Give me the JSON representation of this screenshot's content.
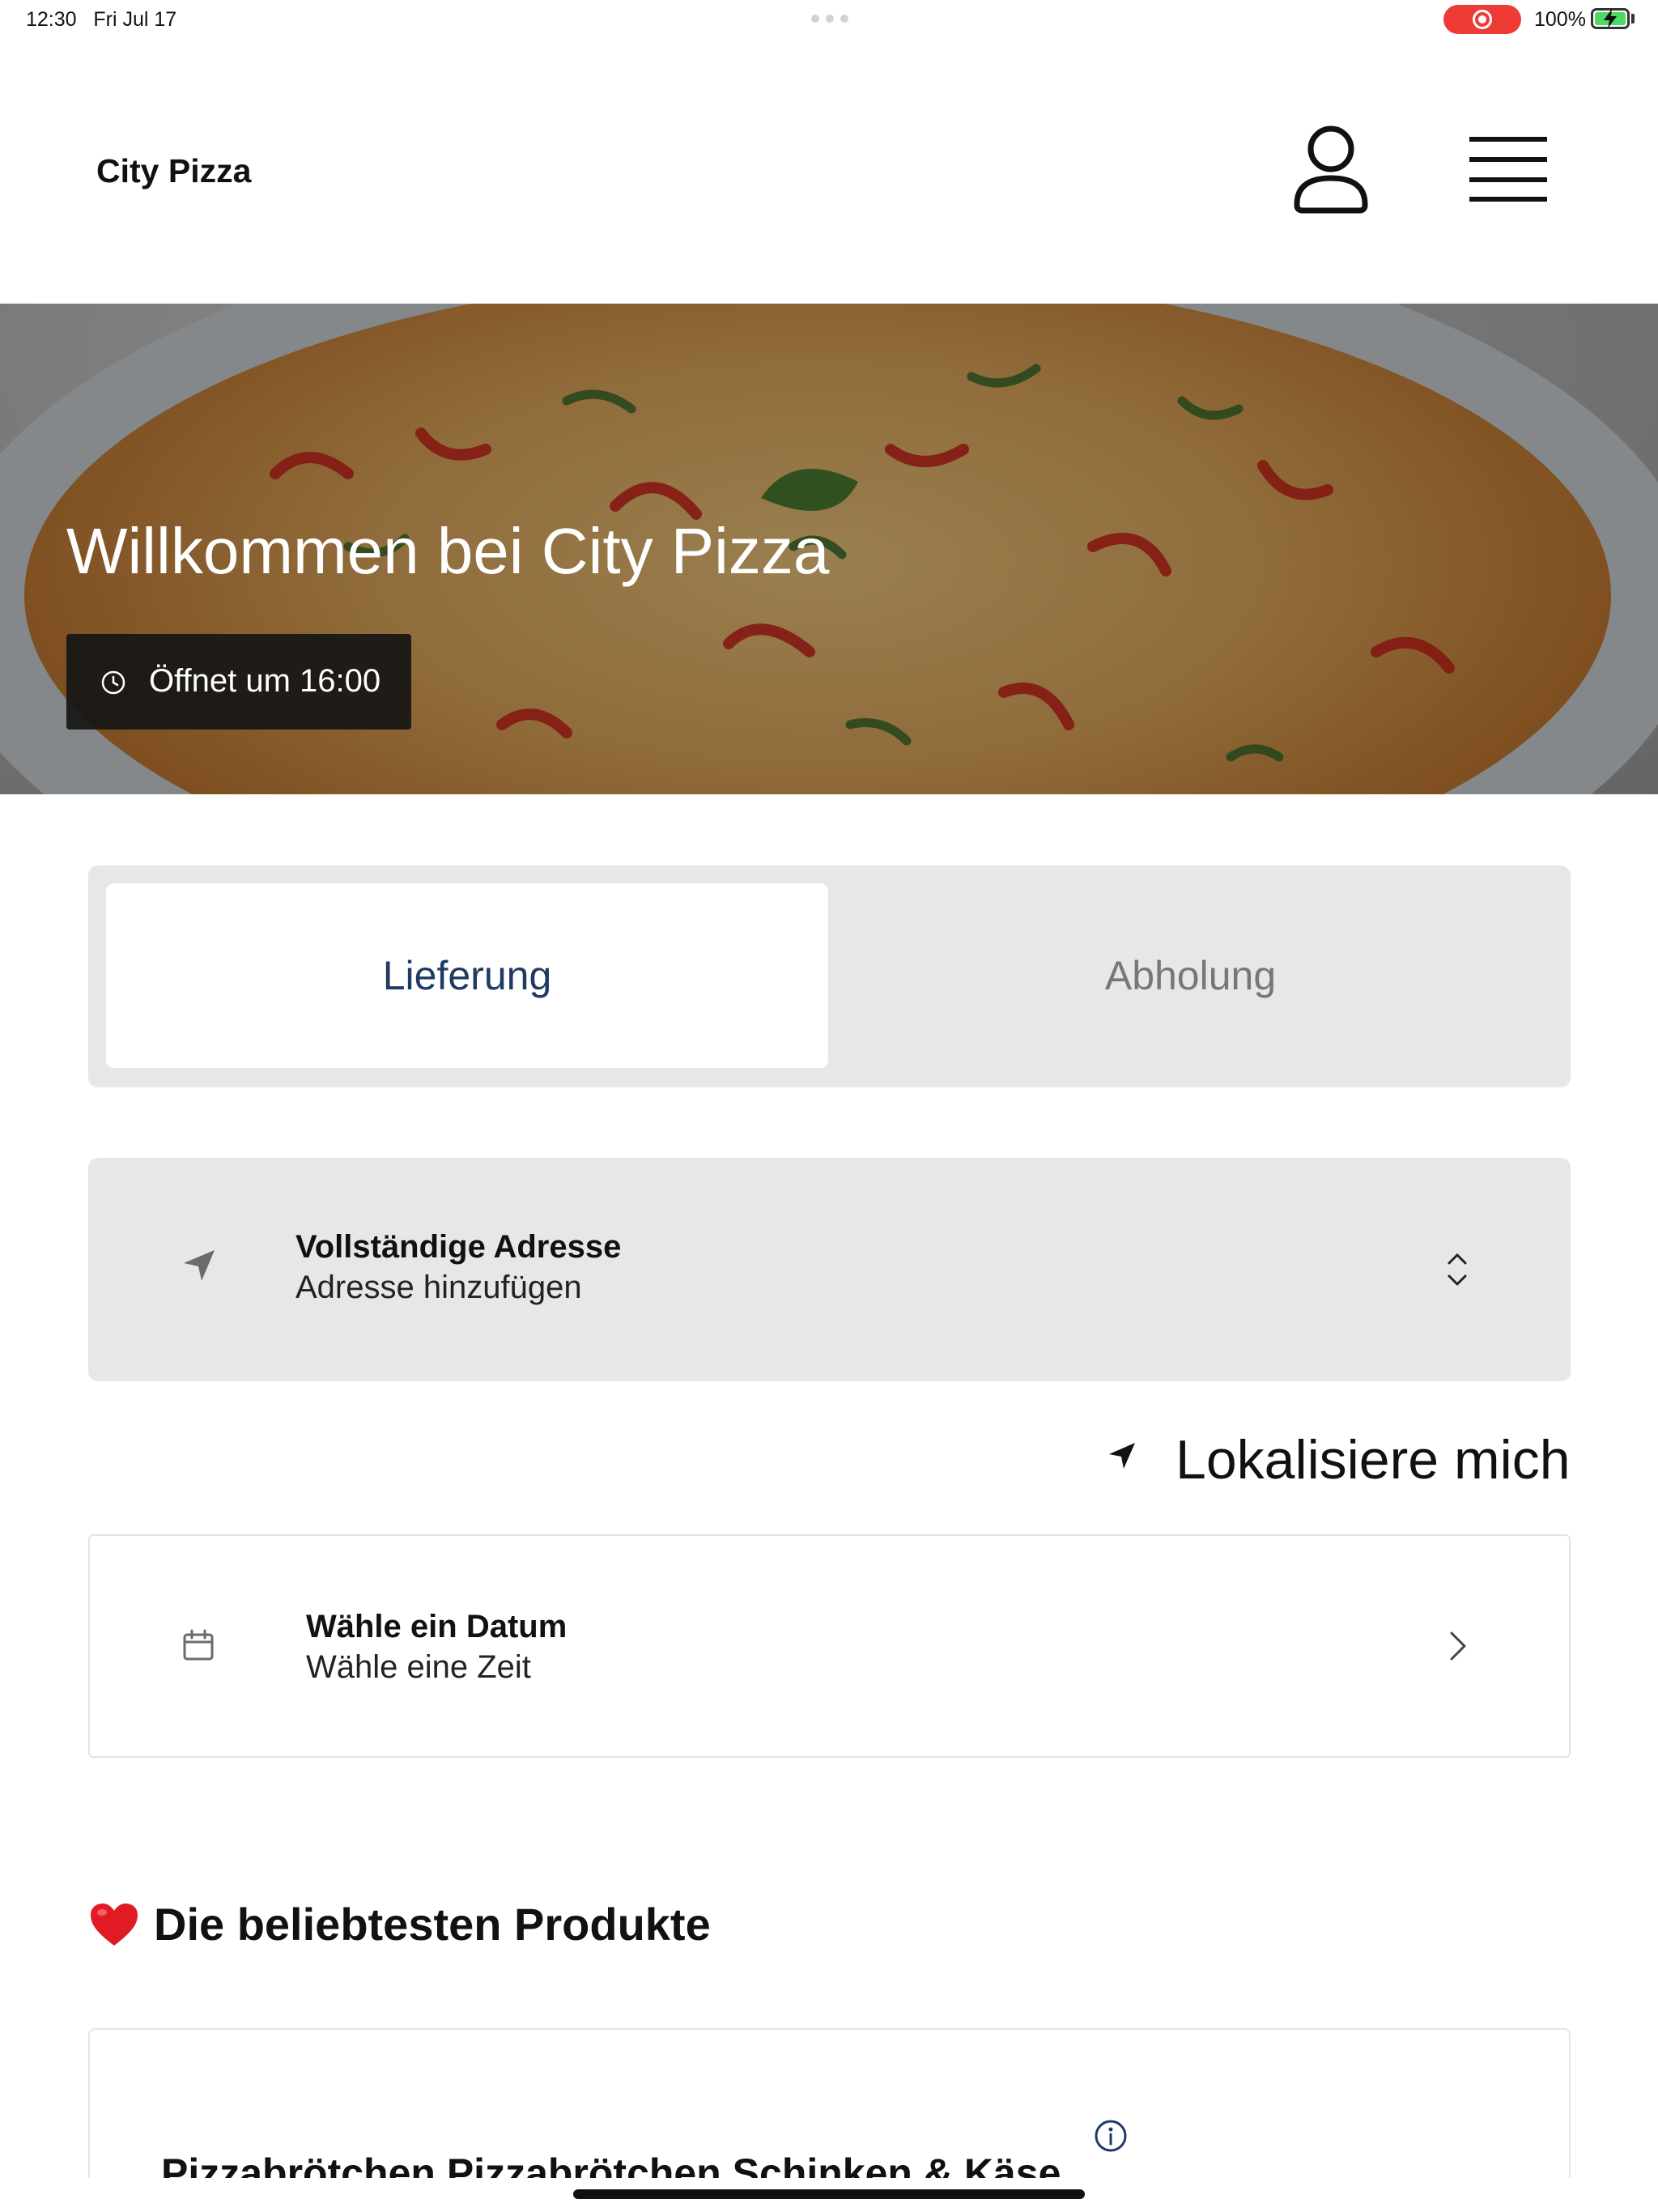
{
  "status_bar": {
    "time": "12:30",
    "date": "Fri Jul 17",
    "battery_percent": "100%",
    "battery_level": 1.0,
    "recording_color": "#ef3b36"
  },
  "header": {
    "brand": "City Pizza",
    "icons": [
      "user-icon",
      "menu-icon"
    ]
  },
  "hero": {
    "title": "Willkommen bei City Pizza",
    "opening_badge": "Öffnet um 16:00",
    "badge_icon": "clock-icon"
  },
  "order_mode": {
    "options": [
      "Lieferung",
      "Abholung"
    ],
    "selected": "Lieferung",
    "accent_color": "#1f3a63"
  },
  "address": {
    "title": "Vollständige Adresse",
    "placeholder": "Adresse hinzufügen",
    "icon": "navigation-arrow-icon"
  },
  "locate": {
    "label": "Lokalisiere mich",
    "icon": "location-arrow-icon"
  },
  "date_picker": {
    "title": "Wähle ein Datum",
    "subtitle": "Wähle eine Zeit",
    "icon": "calendar-icon"
  },
  "products": {
    "section_title": "Die beliebtesten Produkte",
    "section_emoji": "❤️",
    "items": [
      {
        "name": "Pizzabrötchen Pizzabrötchen Schinken & Käse"
      }
    ]
  }
}
